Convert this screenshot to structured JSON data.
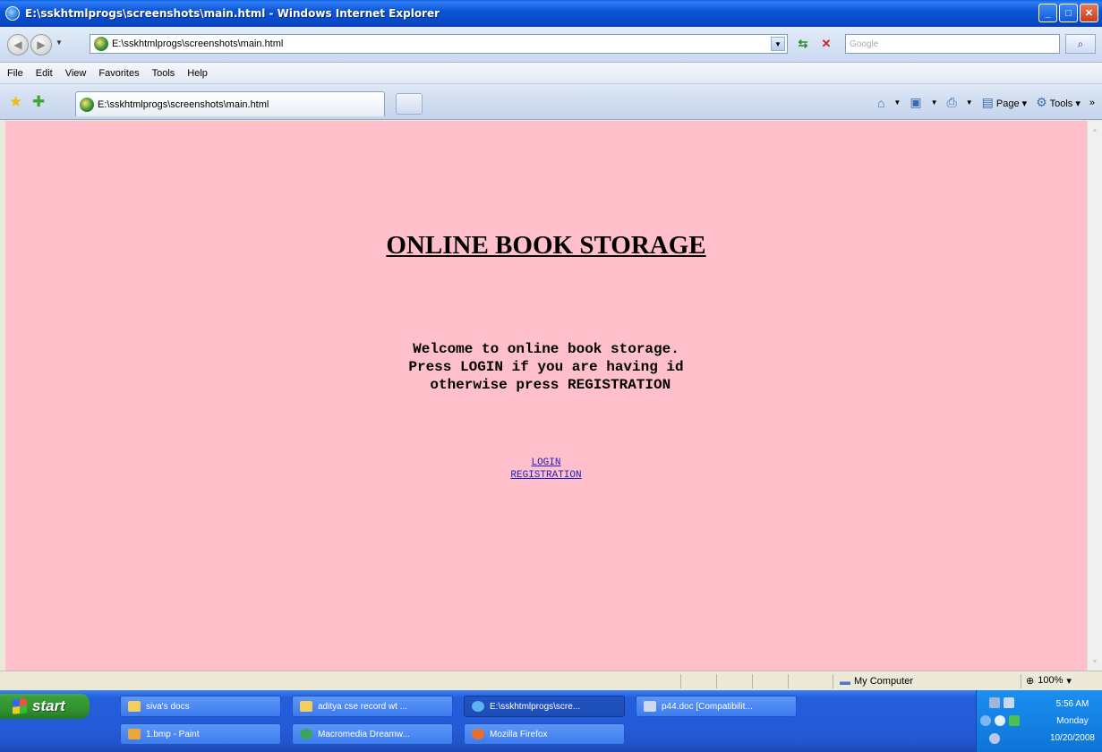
{
  "window": {
    "title": "E:\\sskhtmlprogs\\screenshots\\main.html - Windows Internet Explorer",
    "minimize_glyph": "_",
    "maximize_glyph": "□",
    "close_glyph": "✕"
  },
  "address_bar": {
    "url": "E:\\sskhtmlprogs\\screenshots\\main.html",
    "search_placeholder": "Google"
  },
  "menu": [
    "File",
    "Edit",
    "View",
    "Favorites",
    "Tools",
    "Help"
  ],
  "tabs": [
    {
      "label": "E:\\sskhtmlprogs\\screenshots\\main.html"
    }
  ],
  "command_bar": {
    "page_label": "Page",
    "tools_label": "Tools"
  },
  "page": {
    "heading": "ONLINE BOOK STORAGE",
    "welcome_lines": [
      "Welcome to online book storage.",
      "Press LOGIN if you are having id",
      " otherwise press REGISTRATION"
    ],
    "links": {
      "login": "LOGIN",
      "registration": "REGISTRATION"
    },
    "background_color": "#ffc0cb"
  },
  "status_bar": {
    "zone": "My Computer",
    "zoom": "100%"
  },
  "taskbar": {
    "start_label": "start",
    "tasks_row1": [
      {
        "label": "siva's docs",
        "icon": "folder-icon"
      },
      {
        "label": "aditya cse record wt ...",
        "icon": "folder-icon"
      },
      {
        "label": "E:\\sskhtmlprogs\\scre...",
        "icon": "ie-icon",
        "active": true
      },
      {
        "label": "p44.doc [Compatibilit...",
        "icon": "word-icon"
      }
    ],
    "tasks_row2": [
      {
        "label": "1.bmp - Paint",
        "icon": "paint-icon"
      },
      {
        "label": "Macromedia Dreamw...",
        "icon": "dreamweaver-icon"
      },
      {
        "label": "Mozilla Firefox",
        "icon": "firefox-icon"
      }
    ],
    "clock": {
      "time": "5:56 AM",
      "day": "Monday",
      "date": "10/20/2008"
    }
  }
}
